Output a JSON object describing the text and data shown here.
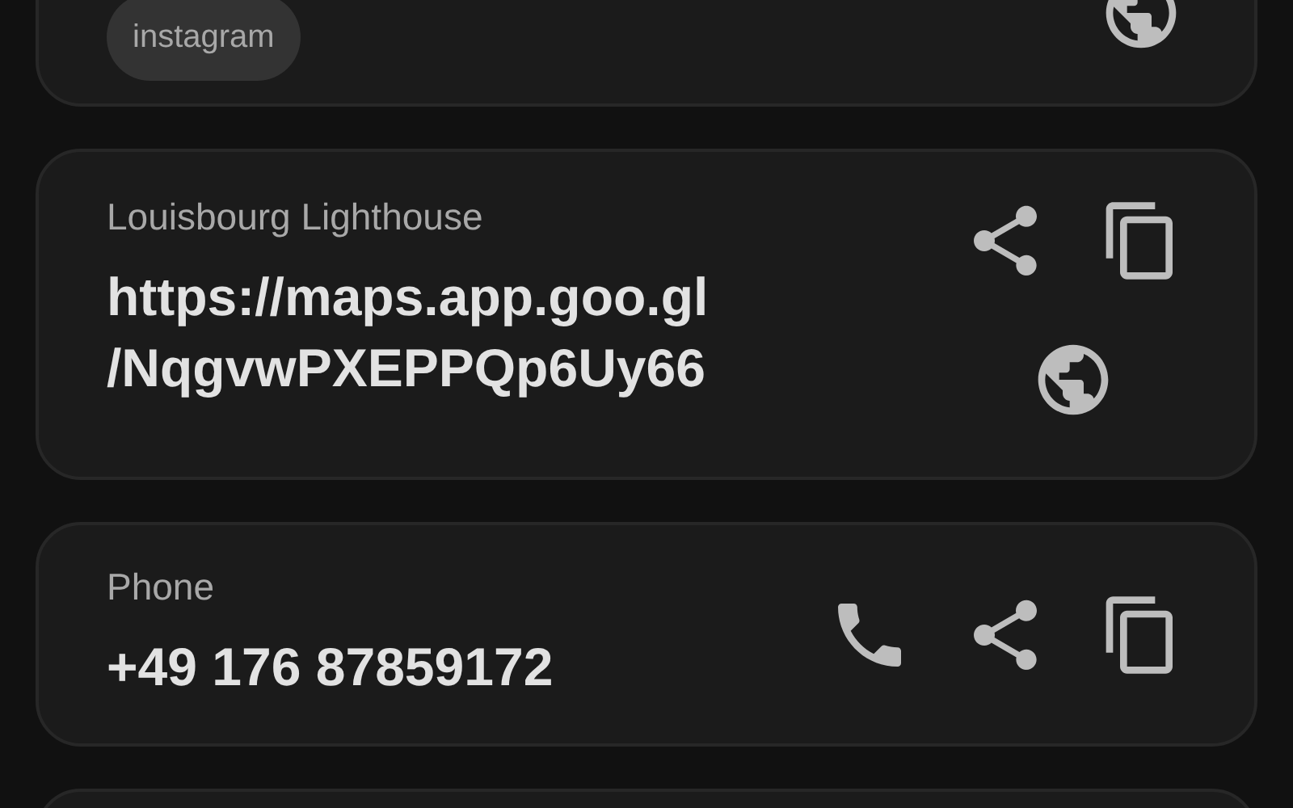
{
  "cards": [
    {
      "kind": "tag",
      "tag": "instagram"
    },
    {
      "kind": "link",
      "label": "Louisbourg Lighthouse",
      "value_lines": [
        "https://maps.app.goo.gl",
        "/NqgvwPXEPPQp6Uy66"
      ]
    },
    {
      "kind": "phone",
      "label": "Phone",
      "value_lines": [
        "+49 176 87859172"
      ]
    },
    {
      "kind": "blank"
    }
  ]
}
